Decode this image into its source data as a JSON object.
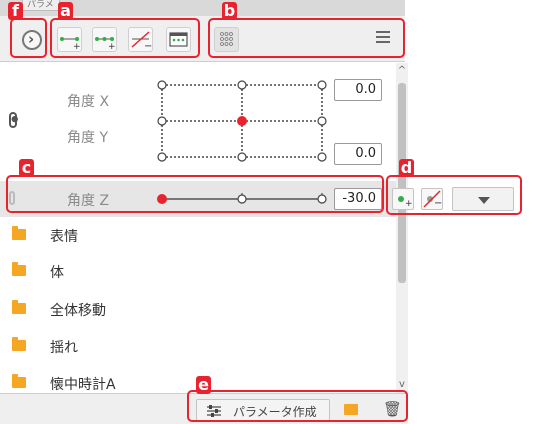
{
  "top_tab_label": "パラメ",
  "toolbar": {
    "collapse_button": "›",
    "menu_icon": "menu-icon"
  },
  "params": {
    "angle_x": {
      "label": "角度 X",
      "value": "0.0"
    },
    "angle_y": {
      "label": "角度 Y",
      "value": "0.0"
    },
    "angle_z": {
      "label": "角度 Z",
      "value": "-30.0"
    }
  },
  "list_items": [
    {
      "label": "表情"
    },
    {
      "label": "体"
    },
    {
      "label": "全体移動"
    },
    {
      "label": "揺れ"
    },
    {
      "label": "懐中時計A"
    }
  ],
  "bottom": {
    "create_label": "パラメータ作成"
  },
  "highlight_labels": {
    "a": "a",
    "b": "b",
    "c": "c",
    "d": "d",
    "e": "e",
    "f": "f"
  },
  "colors": {
    "highlight": "#e8232f",
    "active_point": "#e8232f",
    "folder": "#f5a623",
    "add_key_green": "#2fae4a"
  }
}
